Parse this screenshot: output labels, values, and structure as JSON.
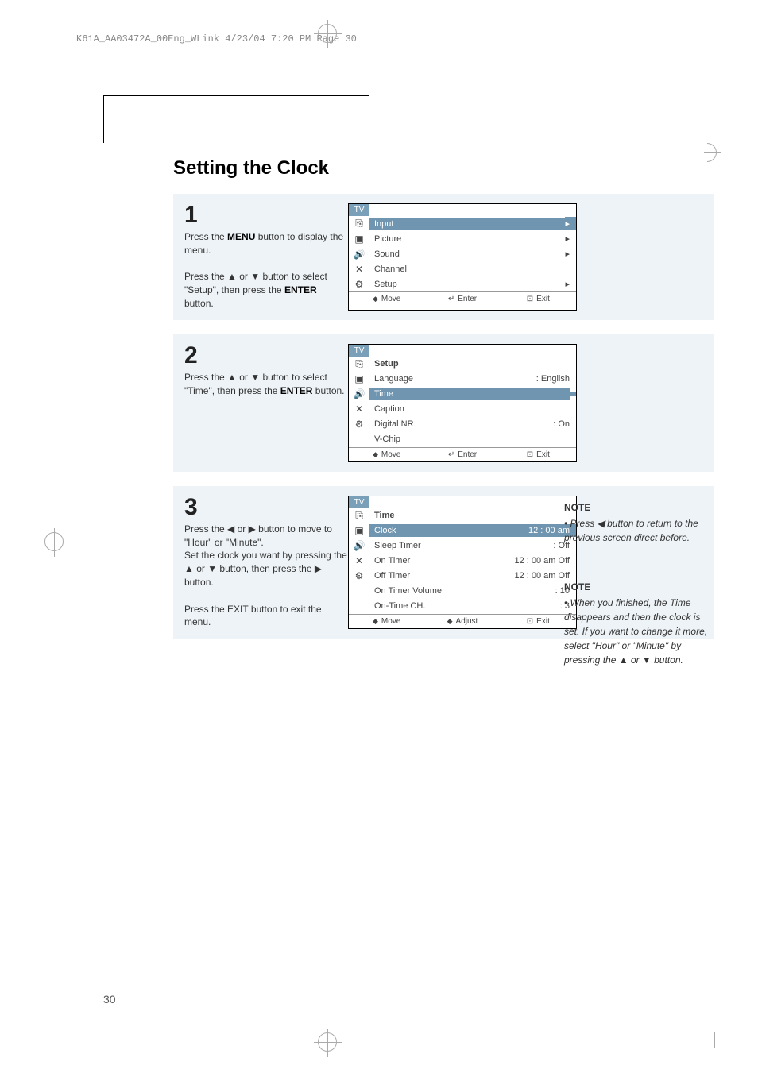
{
  "header_line": "K61A_AA03472A_00Eng_WLink  4/23/04  7:20 PM  Page 30",
  "title": "Setting the Clock",
  "steps": [
    {
      "num": "1",
      "para1_a": "Press the ",
      "para1_b": "MENU",
      "para1_c": " button to display the menu.",
      "para2_a": "Press the ▲ or ▼ button to select \"Setup\", then press the ",
      "para2_b": "ENTER",
      "para2_c": " button."
    },
    {
      "num": "2",
      "para1_a": "Press the ▲ or ▼ button to select \"Time\", then press the ",
      "para1_b": "ENTER",
      "para1_c": " button."
    },
    {
      "num": "3",
      "para1": "Press the ◀ or ▶ button to move to \"Hour\" or \"Minute\".",
      "para2": "Set the clock you want by pressing the ▲ or ▼ button, then press the ▶ button.",
      "para3": "Press the EXIT button to exit the menu."
    }
  ],
  "menus": {
    "main": {
      "title": "TV",
      "rows": [
        {
          "label": "Input",
          "value": "▸"
        },
        {
          "label": "Picture",
          "value": "▸"
        },
        {
          "label": "Sound",
          "value": "▸"
        },
        {
          "label": "Channel",
          "value": ""
        },
        {
          "label": "Setup",
          "value": "▸"
        }
      ],
      "highlight_index": 0,
      "footer": [
        "Move",
        "Enter",
        "Exit"
      ]
    },
    "setup": {
      "title": "TV",
      "heading": "Setup",
      "rows": [
        {
          "label": "Language",
          "value": ": English"
        },
        {
          "label": "Time",
          "value": ""
        },
        {
          "label": "Caption",
          "value": ""
        },
        {
          "label": "Digital NR",
          "value": ": On"
        },
        {
          "label": "V-Chip",
          "value": ""
        }
      ],
      "highlight_index": 1,
      "footer": [
        "Move",
        "Enter",
        "Exit"
      ]
    },
    "time": {
      "title": "TV",
      "heading": "Time",
      "rows": [
        {
          "label": "Clock",
          "value": "12 : 00 am"
        },
        {
          "label": "Sleep Timer",
          "value": ": Off"
        },
        {
          "label": "On Timer",
          "value": "12 : 00 am Off"
        },
        {
          "label": "Off Timer",
          "value": "12 : 00 am Off"
        },
        {
          "label": "On Timer Volume",
          "value": ": 10"
        },
        {
          "label": "On-Time CH.",
          "value": ": 3"
        }
      ],
      "highlight_index": 0,
      "footer": [
        "Move",
        "Adjust",
        "Exit"
      ]
    }
  },
  "notes": [
    {
      "title": "NOTE",
      "body": "• Press ◀ button to return to the previous screen direct before."
    },
    {
      "title": "NOTE",
      "body": "• When you finished, the Time disappears and then the clock is set. If you want to change it more, select \"Hour\" or \"Minute\" by pressing the ▲ or ▼ button."
    }
  ],
  "page_number": "30",
  "icons": {
    "updown": "◆",
    "leftright": "◆",
    "enter": "↵",
    "exit": "⊡"
  }
}
